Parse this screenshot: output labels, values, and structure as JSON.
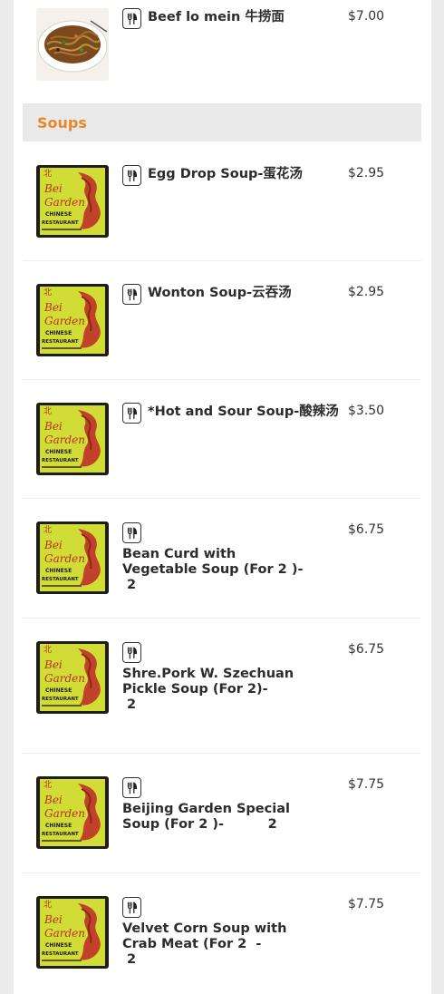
{
  "items_top": [
    {
      "name": "Beef lo mein 牛捞面",
      "price": "$7.00",
      "image": "noodle-photo"
    }
  ],
  "section": {
    "title": "Soups",
    "items": [
      {
        "name": "Egg Drop Soup-蛋花汤",
        "price": "$2.95",
        "image": "restaurant-logo"
      },
      {
        "name": "Wonton Soup-云吞汤",
        "price": "$2.95",
        "image": "restaurant-logo"
      },
      {
        "name": "*Hot and Sour Soup-酸辣汤",
        "price": "$3.50",
        "image": "restaurant-logo"
      },
      {
        "name": "Bean Curd with Vegetable Soup (For 2 )-　　　　　　 2",
        "price": "$6.75",
        "image": "restaurant-logo"
      },
      {
        "name": "Shre.Pork W. Szechuan Pickle Soup (For 2)-　　　　 2",
        "price": "$6.75",
        "image": "restaurant-logo"
      },
      {
        "name": "Beijing Garden Special Soup (For 2 )-　　　 2",
        "price": "$7.75",
        "image": "restaurant-logo"
      },
      {
        "name": "Velvet Corn Soup with Crab Meat (For 2  -　　　　　 2",
        "price": "$7.75",
        "image": "restaurant-logo"
      }
    ]
  },
  "icons": {
    "item_type": "utensils-icon"
  },
  "colors": {
    "section_title": "#e8882b",
    "section_bg": "#e9e9e9",
    "panel_bg": "#ffffff",
    "page_bg": "#ebebeb"
  }
}
